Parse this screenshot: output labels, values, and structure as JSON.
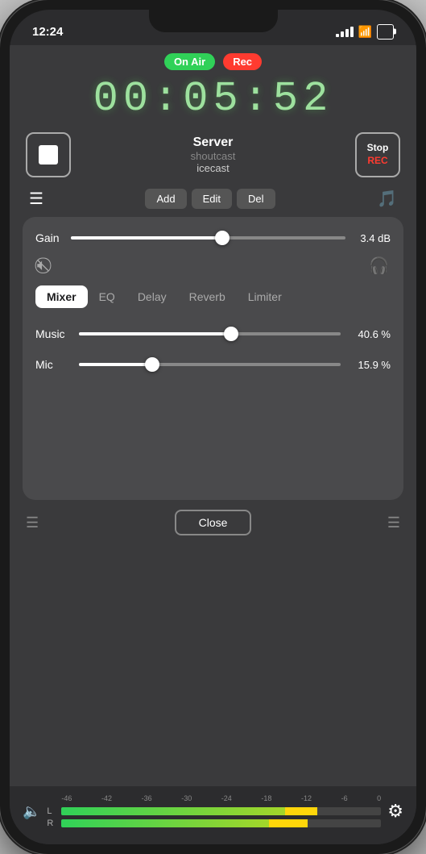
{
  "statusBar": {
    "time": "12:24"
  },
  "badges": {
    "onAir": "On Air",
    "rec": "Rec"
  },
  "timer": {
    "display": "00:05:52"
  },
  "server": {
    "title": "Server",
    "inactive": "shoutcast",
    "active": "icecast"
  },
  "buttons": {
    "stop": "Stop",
    "stopRec": "Stop",
    "recLabel": "REC",
    "add": "Add",
    "edit": "Edit",
    "del": "Del",
    "close": "Close"
  },
  "gain": {
    "label": "Gain",
    "value": "3.4 dB",
    "pct": 55
  },
  "tabs": {
    "items": [
      "Mixer",
      "EQ",
      "Delay",
      "Reverb",
      "Limiter"
    ],
    "active": "Mixer"
  },
  "mixerSliders": [
    {
      "label": "Music",
      "value": "40.6 %",
      "pct": 58
    },
    {
      "label": "Mic",
      "value": "15.9 %",
      "pct": 28
    }
  ],
  "vuMeter": {
    "labels": [
      "-46",
      "-42",
      "-36",
      "-30",
      "-24",
      "-18",
      "-12",
      "-6",
      "0"
    ],
    "channels": [
      {
        "label": "L",
        "greenPct": 70,
        "yellowPct": 10,
        "redPct": 0
      },
      {
        "label": "R",
        "greenPct": 65,
        "yellowPct": 12,
        "redPct": 0
      }
    ]
  }
}
